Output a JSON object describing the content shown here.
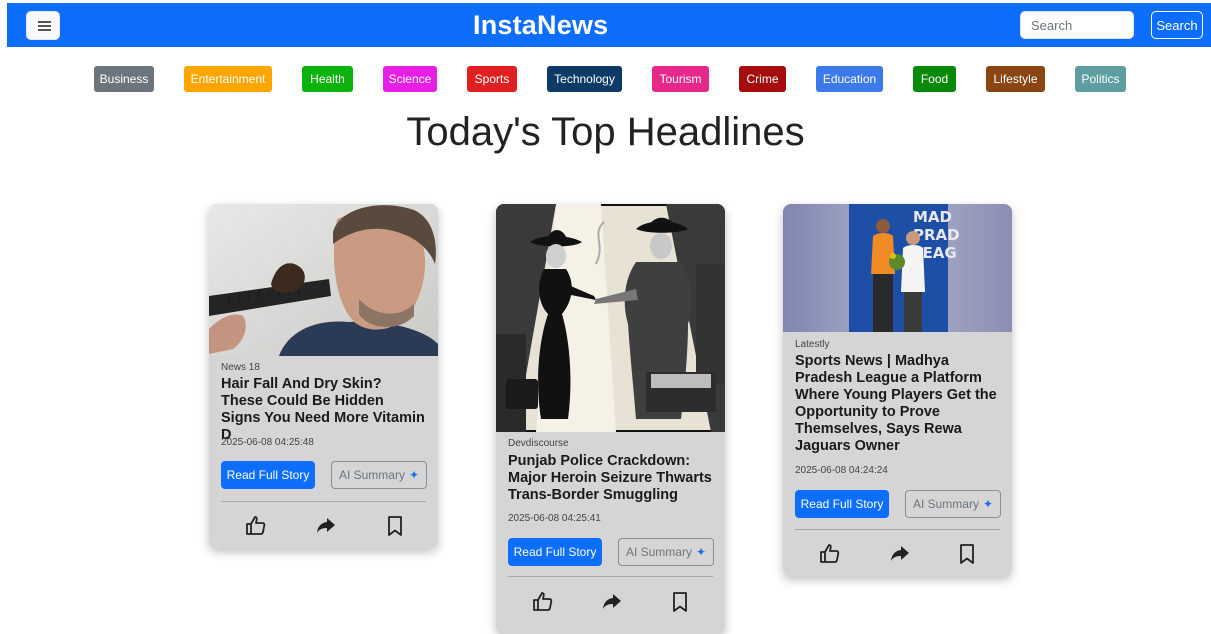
{
  "header": {
    "brand": "InstaNews",
    "search_placeholder": "Search",
    "search_button": "Search",
    "bg_color": "#0d6efd"
  },
  "categories": [
    {
      "label": "Business",
      "color": "#6c757d"
    },
    {
      "label": "Entertainment",
      "color": "#ffa500"
    },
    {
      "label": "Health",
      "color": "#0db30d"
    },
    {
      "label": "Science",
      "color": "#e61ee6"
    },
    {
      "label": "Sports",
      "color": "#e02020"
    },
    {
      "label": "Technology",
      "color": "#0d3b66"
    },
    {
      "label": "Tourism",
      "color": "#e6288a"
    },
    {
      "label": "Crime",
      "color": "#a50e0e"
    },
    {
      "label": "Education",
      "color": "#3b7ae8"
    },
    {
      "label": "Food",
      "color": "#088a08"
    },
    {
      "label": "Lifestyle",
      "color": "#8b4513"
    },
    {
      "label": "Politics",
      "color": "#5f9ea0"
    }
  ],
  "page_title": "Today's Top Headlines",
  "articles": [
    {
      "source": "News 18",
      "title": "Hair Fall And Dry Skin? These Could Be Hidden Signs You Need More Vitamin D",
      "date": "2025-06-08 04:25:48",
      "read_label": "Read Full Story",
      "ai_label": "AI Summary"
    },
    {
      "source": "Devdiscourse",
      "title": "Punjab Police Crackdown: Major Heroin Seizure Thwarts Trans-Border Smuggling",
      "date": "2025-06-08 04:25:41",
      "read_label": "Read Full Story",
      "ai_label": "AI Summary"
    },
    {
      "source": "Latestly",
      "title": "Sports News | Madhya Pradesh League a Platform Where Young Players Get the Opportunity to Prove Themselves, Says Rewa Jaguars Owner",
      "date": "2025-06-08 04:24:24",
      "read_label": "Read Full Story",
      "ai_label": "AI Summary"
    }
  ],
  "icons": {
    "menu": "hamburger-icon",
    "like": "thumbs-up-icon",
    "share": "share-arrow-icon",
    "bookmark": "bookmark-icon",
    "sparkle": "sparkle-icon"
  },
  "image_text": {
    "banner_line1": "MAD",
    "banner_line2": "PRAD",
    "banner_line3": "LEAG"
  }
}
